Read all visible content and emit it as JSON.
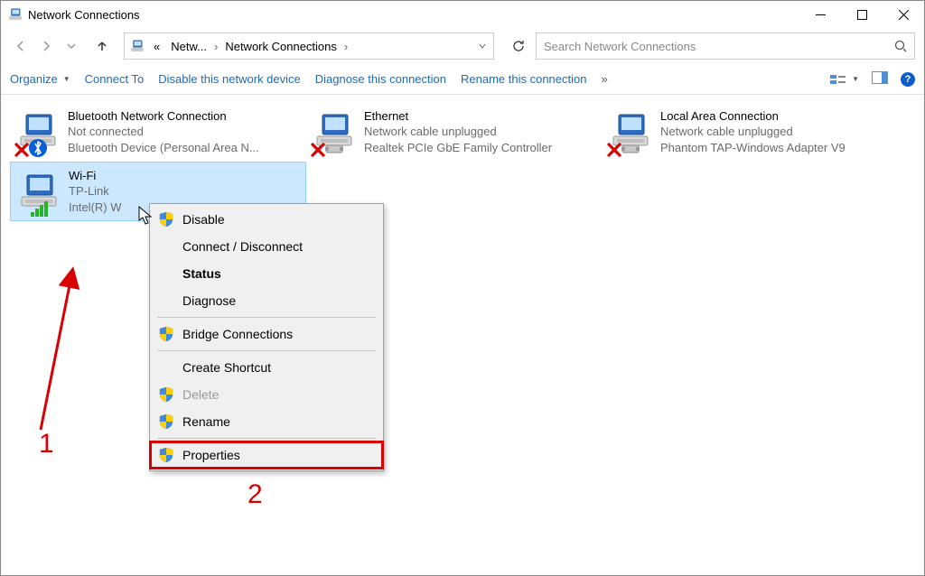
{
  "window": {
    "title": "Network Connections"
  },
  "breadcrumb": {
    "root_abbrev": "«",
    "level1": "Netw...",
    "level2": "Network Connections"
  },
  "search": {
    "placeholder": "Search Network Connections"
  },
  "toolbar": {
    "organize": "Organize",
    "connect_to": "Connect To",
    "disable": "Disable this network device",
    "diagnose": "Diagnose this connection",
    "rename": "Rename this connection",
    "overflow": "»"
  },
  "connections": [
    {
      "name": "Bluetooth Network Connection",
      "status": "Not connected",
      "device": "Bluetooth Device (Personal Area N...",
      "badge": "bluetooth",
      "disabled_x": true
    },
    {
      "name": "Ethernet",
      "status": "Network cable unplugged",
      "device": "Realtek PCIe GbE Family Controller",
      "badge": "ethernet",
      "disabled_x": true
    },
    {
      "name": "Local Area Connection",
      "status": "Network cable unplugged",
      "device": "Phantom TAP-Windows Adapter V9",
      "badge": "ethernet",
      "disabled_x": true
    },
    {
      "name": "Wi-Fi",
      "status": "TP-Link",
      "device": "Intel(R) W",
      "badge": "wifi-bars",
      "disabled_x": false,
      "selected": true
    }
  ],
  "context_menu": {
    "items": [
      {
        "label": "Disable",
        "shield": true
      },
      {
        "label": "Connect / Disconnect"
      },
      {
        "label": "Status",
        "bold": true
      },
      {
        "label": "Diagnose"
      },
      {
        "sep": true
      },
      {
        "label": "Bridge Connections",
        "shield": true
      },
      {
        "sep": true
      },
      {
        "label": "Create Shortcut"
      },
      {
        "label": "Delete",
        "shield": true,
        "disabled": true
      },
      {
        "label": "Rename",
        "shield": true
      },
      {
        "sep": true
      },
      {
        "label": "Properties",
        "shield": true,
        "highlighted": true
      }
    ]
  },
  "annotations": {
    "num1": "1",
    "num2": "2"
  }
}
